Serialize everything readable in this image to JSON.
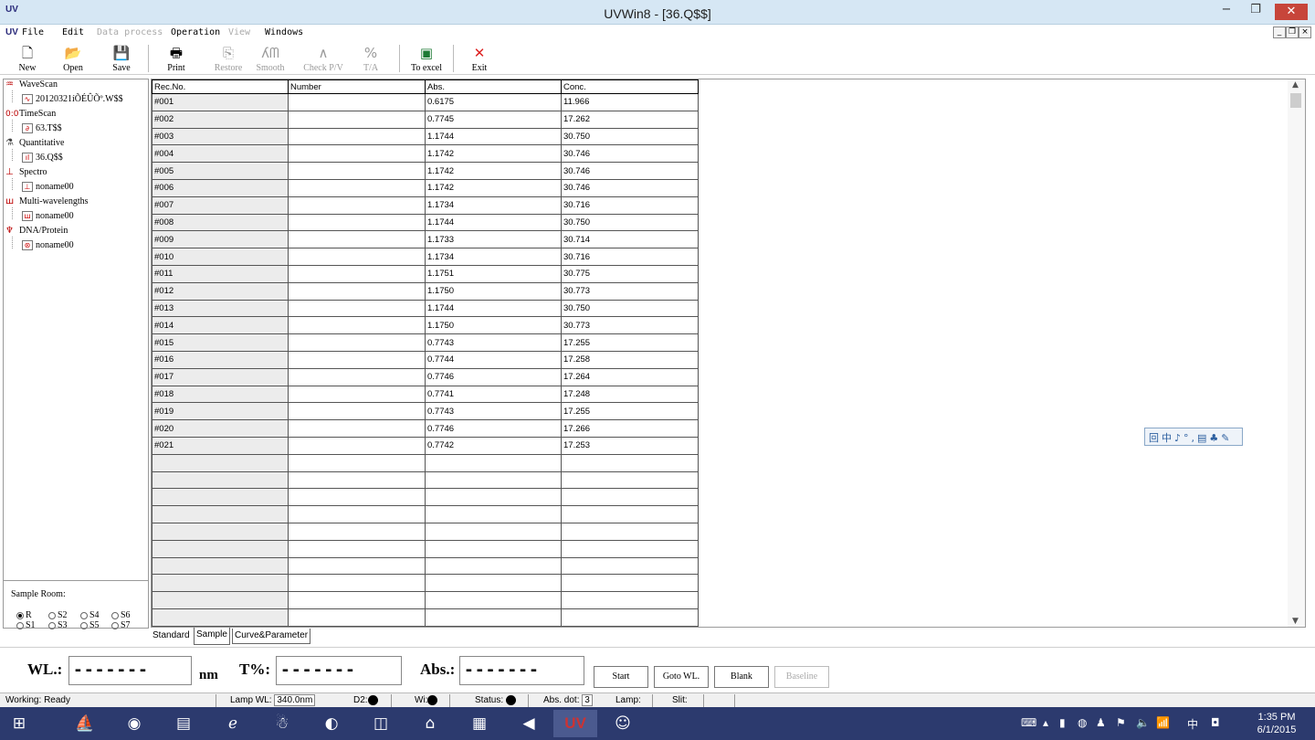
{
  "window": {
    "app_logo": "UV",
    "title": "UVWin8 - [36.Q$$]",
    "minimize": "−",
    "restore": "❐",
    "close": "✕"
  },
  "menu": {
    "logo": "UV",
    "items": [
      "File",
      "Edit",
      "Data process",
      "Operation",
      "View",
      "Windows"
    ]
  },
  "mdi": {
    "minimize": "_",
    "restore": "❐",
    "close": "×"
  },
  "toolbar": {
    "new": "New",
    "open": "Open",
    "save": "Save",
    "print": "Print",
    "restore": "Restore",
    "smooth": "Smooth",
    "check_pv": "Check P/V",
    "ta": "T/A",
    "to_excel": "To excel",
    "exit": "Exit"
  },
  "tree": [
    {
      "label": "WaveScan",
      "icon": "wavescan-icon",
      "child": "20120321íÕÉÛÕº.W$$"
    },
    {
      "label": "TimeScan",
      "icon": "timescan-icon",
      "child": "63.T$$"
    },
    {
      "label": "Quantitative",
      "icon": "quantitative-icon",
      "child": "36.Q$$"
    },
    {
      "label": "Spectro",
      "icon": "spectro-icon",
      "child": "noname00"
    },
    {
      "label": "Multi-wavelengths",
      "icon": "multi-wavelengths-icon",
      "child": "noname00"
    },
    {
      "label": "DNA/Protein",
      "icon": "dna-protein-icon",
      "child": "noname00"
    }
  ],
  "sample_room": {
    "label": "Sample Room:",
    "options": [
      "R",
      "S2",
      "S4",
      "S6",
      "S1",
      "S3",
      "S5",
      "S7"
    ],
    "selected": "R"
  },
  "table": {
    "headers": [
      "Rec.No.",
      "Number",
      "Abs.",
      "Conc."
    ],
    "rows": [
      [
        "#001",
        "",
        "0.6175",
        "11.966"
      ],
      [
        "#002",
        "",
        "0.7745",
        "17.262"
      ],
      [
        "#003",
        "",
        "1.1744",
        "30.750"
      ],
      [
        "#004",
        "",
        "1.1742",
        "30.746"
      ],
      [
        "#005",
        "",
        "1.1742",
        "30.746"
      ],
      [
        "#006",
        "",
        "1.1742",
        "30.746"
      ],
      [
        "#007",
        "",
        "1.1734",
        "30.716"
      ],
      [
        "#008",
        "",
        "1.1744",
        "30.750"
      ],
      [
        "#009",
        "",
        "1.1733",
        "30.714"
      ],
      [
        "#010",
        "",
        "1.1734",
        "30.716"
      ],
      [
        "#011",
        "",
        "1.1751",
        "30.775"
      ],
      [
        "#012",
        "",
        "1.1750",
        "30.773"
      ],
      [
        "#013",
        "",
        "1.1744",
        "30.750"
      ],
      [
        "#014",
        "",
        "1.1750",
        "30.773"
      ],
      [
        "#015",
        "",
        "0.7743",
        "17.255"
      ],
      [
        "#016",
        "",
        "0.7744",
        "17.258"
      ],
      [
        "#017",
        "",
        "0.7746",
        "17.264"
      ],
      [
        "#018",
        "",
        "0.7741",
        "17.248"
      ],
      [
        "#019",
        "",
        "0.7743",
        "17.255"
      ],
      [
        "#020",
        "",
        "0.7746",
        "17.266"
      ],
      [
        "#021",
        "",
        "0.7742",
        "17.253"
      ]
    ],
    "empty_rows": 11
  },
  "tabs": [
    "Standard",
    "Sample",
    "Curve&Parameter"
  ],
  "active_tab": "Sample",
  "readout": {
    "wl_label": "WL.:",
    "wl_value": "-------",
    "wl_unit": "nm",
    "t_label": "T%:",
    "t_value": "-------",
    "abs_label": "Abs.:",
    "abs_value": "-------",
    "start": "Start",
    "goto": "Goto WL.",
    "blank": "Blank",
    "baseline": "Baseline"
  },
  "status": {
    "working_label": "Working:",
    "working": "Ready",
    "lamp_wl_label": "Lamp WL:",
    "lamp_wl": "340.0nm",
    "d2_label": "D2:",
    "wi_label": "Wi:",
    "status_label": "Status:",
    "abs_dot_label": "Abs. dot:",
    "abs_dot": "3",
    "lamp_label": "Lamp:",
    "slit_label": "Slit:"
  },
  "ime": "回中♪°,▤♣✎",
  "taskbar": {
    "time": "1:35 PM",
    "date": "6/1/2015",
    "uv_label": "UV",
    "ime_lang": "中"
  },
  "colors": {
    "titlebar": "#d6e7f4",
    "close": "#c7453a",
    "taskbar": "#2c3a6e"
  }
}
